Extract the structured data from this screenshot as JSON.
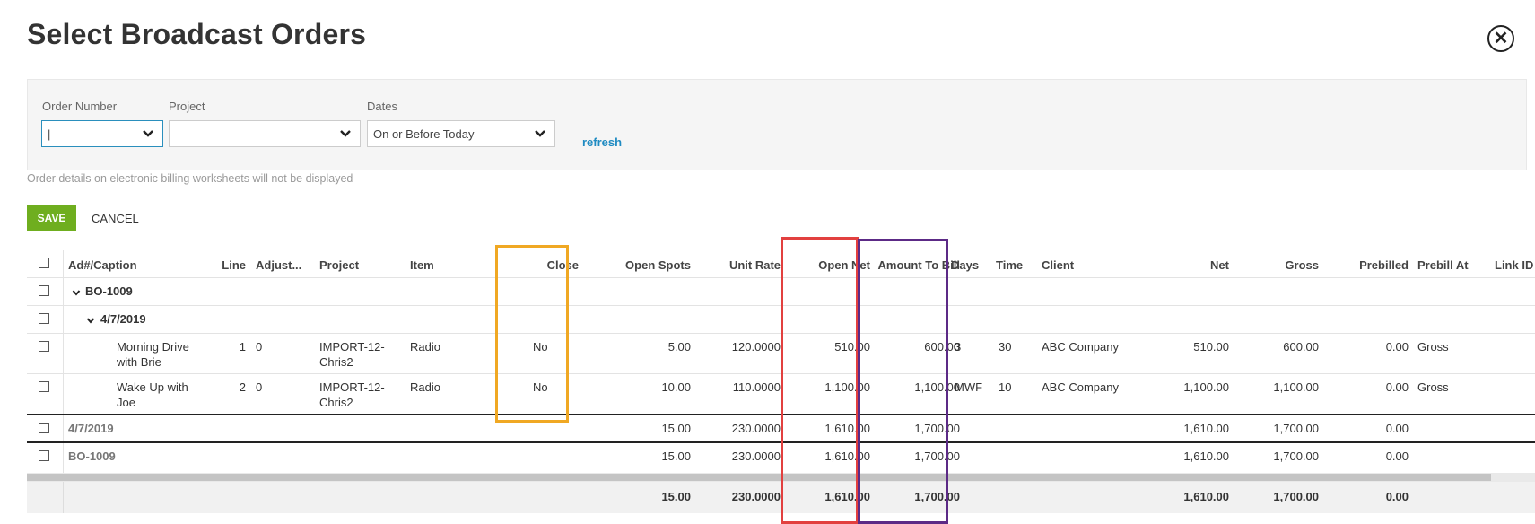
{
  "dialog": {
    "title": "Select Broadcast Orders"
  },
  "filters": {
    "order_number": {
      "label": "Order Number",
      "value": "|"
    },
    "project": {
      "label": "Project",
      "value": ""
    },
    "dates": {
      "label": "Dates",
      "value": "On or Before Today"
    },
    "refresh_label": "refresh"
  },
  "note": "Order details on electronic billing worksheets will not be displayed",
  "actions": {
    "save_label": "SAVE",
    "cancel_label": "CANCEL"
  },
  "columns": {
    "caption": "Ad#/Caption",
    "line": "Line",
    "adjust": "Adjust...",
    "project": "Project",
    "item": "Item",
    "close": "Close",
    "open_spots": "Open Spots",
    "unit_rate": "Unit Rate",
    "open_net": "Open Net",
    "amount_to_bill": "Amount To Bill",
    "days": "Days",
    "time": "Time",
    "client": "Client",
    "net": "Net",
    "gross": "Gross",
    "prebilled": "Prebilled",
    "prebill_at": "Prebill At",
    "link_id": "Link ID"
  },
  "groups": {
    "order": "BO-1009",
    "date": "4/7/2019"
  },
  "rows": [
    {
      "caption_1": "Morning Drive",
      "caption_2": "with Brie",
      "line": "1",
      "adjust": "0",
      "project_1": "IMPORT-12-",
      "project_2": "Chris2",
      "item": "Radio",
      "close": "No",
      "open_spots": "5.00",
      "unit_rate": "120.0000",
      "open_net": "510.00",
      "amount_to_bill": "600.00",
      "days": "3",
      "time": "30",
      "client": "ABC Company",
      "net": "510.00",
      "gross": "600.00",
      "prebilled": "0.00",
      "prebill_at": "Gross"
    },
    {
      "caption_1": "Wake Up with",
      "caption_2": "Joe",
      "line": "2",
      "adjust": "0",
      "project_1": "IMPORT-12-",
      "project_2": "Chris2",
      "item": "Radio",
      "close": "No",
      "open_spots": "10.00",
      "unit_rate": "110.0000",
      "open_net": "1,100.00",
      "amount_to_bill": "1,100.00",
      "days": "MWF",
      "time": "10",
      "client": "ABC Company",
      "net": "1,100.00",
      "gross": "1,100.00",
      "prebilled": "0.00",
      "prebill_at": "Gross"
    }
  ],
  "subtotal_date": {
    "label": "4/7/2019",
    "open_spots": "15.00",
    "unit_rate": "230.0000",
    "open_net": "1,610.00",
    "amount_to_bill": "1,700.00",
    "net": "1,610.00",
    "gross": "1,700.00",
    "prebilled": "0.00"
  },
  "subtotal_order": {
    "label": "BO-1009",
    "open_spots": "15.00",
    "unit_rate": "230.0000",
    "open_net": "1,610.00",
    "amount_to_bill": "1,700.00",
    "net": "1,610.00",
    "gross": "1,700.00",
    "prebilled": "0.00"
  },
  "grand_total": {
    "open_spots": "15.00",
    "unit_rate": "230.0000",
    "open_net": "1,610.00",
    "amount_to_bill": "1,700.00",
    "net": "1,610.00",
    "gross": "1,700.00",
    "prebilled": "0.00"
  },
  "highlight_colors": {
    "close": "#f0a823",
    "open_net": "#e2403f",
    "amount_to_bill": "#5c2a86"
  }
}
